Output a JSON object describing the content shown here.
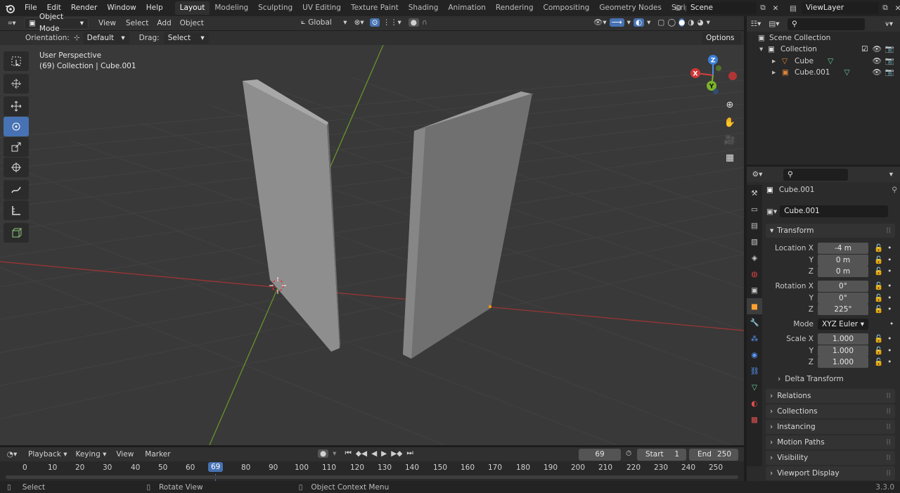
{
  "topbar": {
    "menus": [
      "File",
      "Edit",
      "Render",
      "Window",
      "Help"
    ],
    "workspaces": [
      "Layout",
      "Modeling",
      "Sculpting",
      "UV Editing",
      "Texture Paint",
      "Shading",
      "Animation",
      "Rendering",
      "Compositing",
      "Geometry Nodes",
      "Scripting"
    ],
    "active_workspace": "Layout",
    "add_tab": "+",
    "scene": "Scene",
    "view_layer": "ViewLayer"
  },
  "viewport_header": {
    "mode": "Object Mode",
    "menus": [
      "View",
      "Select",
      "Add",
      "Object"
    ],
    "transform_orientation": "Global"
  },
  "tool_header": {
    "orientation_label": "Orientation:",
    "orientation_value": "Default",
    "drag_label": "Drag:",
    "drag_value": "Select Box",
    "options": "Options"
  },
  "viewport": {
    "perspective": "User Perspective",
    "context": "(69) Collection | Cube.001",
    "gizmo": {
      "x": "X",
      "y": "Y",
      "z": "Z"
    }
  },
  "outliner": {
    "scene_collection": "Scene Collection",
    "collection": "Collection",
    "items": [
      "Cube",
      "Cube.001"
    ]
  },
  "properties": {
    "object_name": "Cube.001",
    "object_field": "Cube.001",
    "transform_label": "Transform",
    "location_x_label": "Location X",
    "location_x": "-4 m",
    "location_y": "0 m",
    "location_z": "0 m",
    "rotation_x_label": "Rotation X",
    "rotation_x": "0°",
    "rotation_y": "0°",
    "rotation_z": "225°",
    "mode_label": "Mode",
    "mode_value": "XYZ Euler",
    "scale_x_label": "Scale X",
    "scale_x": "1.000",
    "scale_y": "1.000",
    "scale_z": "1.000",
    "y_label": "Y",
    "z_label": "Z",
    "delta_transform": "Delta Transform",
    "sections": [
      "Relations",
      "Collections",
      "Instancing",
      "Motion Paths",
      "Visibility",
      "Viewport Display"
    ]
  },
  "timeline": {
    "menus": [
      "Playback",
      "Keying",
      "View",
      "Marker"
    ],
    "current_frame": "69",
    "start_label": "Start",
    "start": "1",
    "end_label": "End",
    "end": "250",
    "ruler": [
      "0",
      "10",
      "20",
      "30",
      "40",
      "50",
      "60",
      "69",
      "80",
      "90",
      "100",
      "110",
      "120",
      "130",
      "140",
      "150",
      "160",
      "170",
      "180",
      "190",
      "200",
      "210",
      "220",
      "230",
      "240",
      "250"
    ]
  },
  "statusbar": {
    "select": "Select",
    "rotate": "Rotate View",
    "context_menu": "Object Context Menu",
    "version": "3.3.0"
  }
}
